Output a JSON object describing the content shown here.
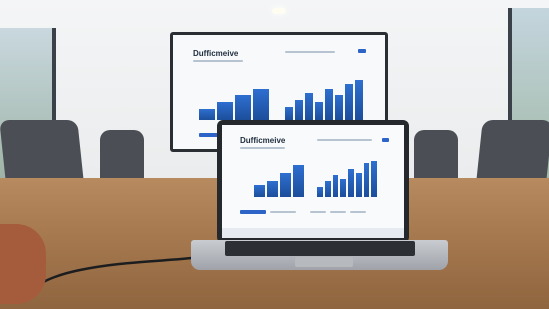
{
  "scene": {
    "tv_screen": {
      "brand_title": "Dufficmeive",
      "left_chart_bars": [
        0.25,
        0.4,
        0.55,
        0.7
      ],
      "right_chart_bars": [
        0.3,
        0.45,
        0.6,
        0.4,
        0.7,
        0.55,
        0.8,
        0.9
      ]
    },
    "laptop_screen": {
      "brand_title": "Dufficmeive",
      "left_chart_bars": [
        0.3,
        0.4,
        0.6,
        0.8
      ],
      "right_chart_bars": [
        0.25,
        0.4,
        0.55,
        0.45,
        0.7,
        0.6,
        0.85,
        0.9
      ]
    },
    "colors": {
      "chart_blue": "#2e6fd0",
      "wood": "#a87a50"
    }
  }
}
